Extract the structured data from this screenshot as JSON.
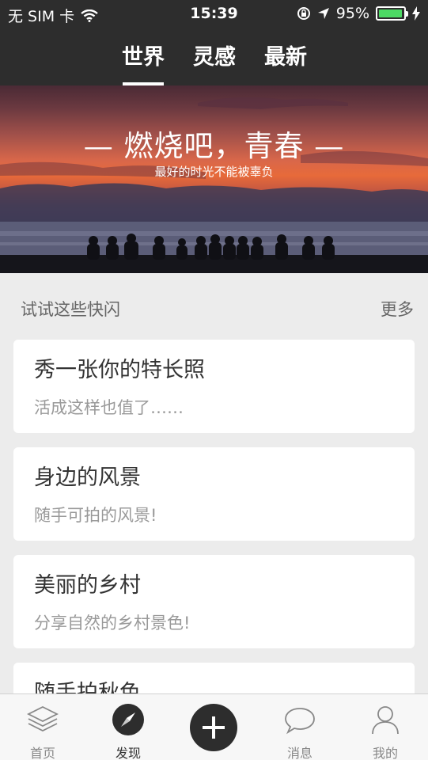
{
  "status_bar": {
    "carrier": "无 SIM 卡",
    "time": "15:39",
    "battery_text": "95%",
    "battery_level": 0.95,
    "battery_color": "#4cd964"
  },
  "top_tabs": [
    {
      "label": "世界",
      "active": true
    },
    {
      "label": "灵感",
      "active": false
    },
    {
      "label": "最新",
      "active": false
    }
  ],
  "banner": {
    "title": "— 燃烧吧，青春 —",
    "subtitle": "最好的时光不能被辜负"
  },
  "section": {
    "title": "试试这些快闪",
    "more": "更多"
  },
  "cards": [
    {
      "title": "秀一张你的特长照",
      "desc": "活成这样也值了……"
    },
    {
      "title": "身边的风景",
      "desc": "随手可拍的风景!"
    },
    {
      "title": "美丽的乡村",
      "desc": "分享自然的乡村景色!"
    },
    {
      "title": "随手拍秋色",
      "desc": ""
    }
  ],
  "tab_bar": {
    "items": [
      {
        "label": "首页",
        "icon": "layers-icon",
        "active": false
      },
      {
        "label": "发现",
        "icon": "compass-icon",
        "active": true
      },
      {
        "label": "",
        "icon": "plus-icon",
        "active": false
      },
      {
        "label": "消息",
        "icon": "chat-bubble-icon",
        "active": false
      },
      {
        "label": "我的",
        "icon": "user-icon",
        "active": false
      }
    ]
  },
  "colors": {
    "header_bg": "#2d2d2d",
    "page_bg": "#ececec",
    "card_bg": "#ffffff"
  }
}
